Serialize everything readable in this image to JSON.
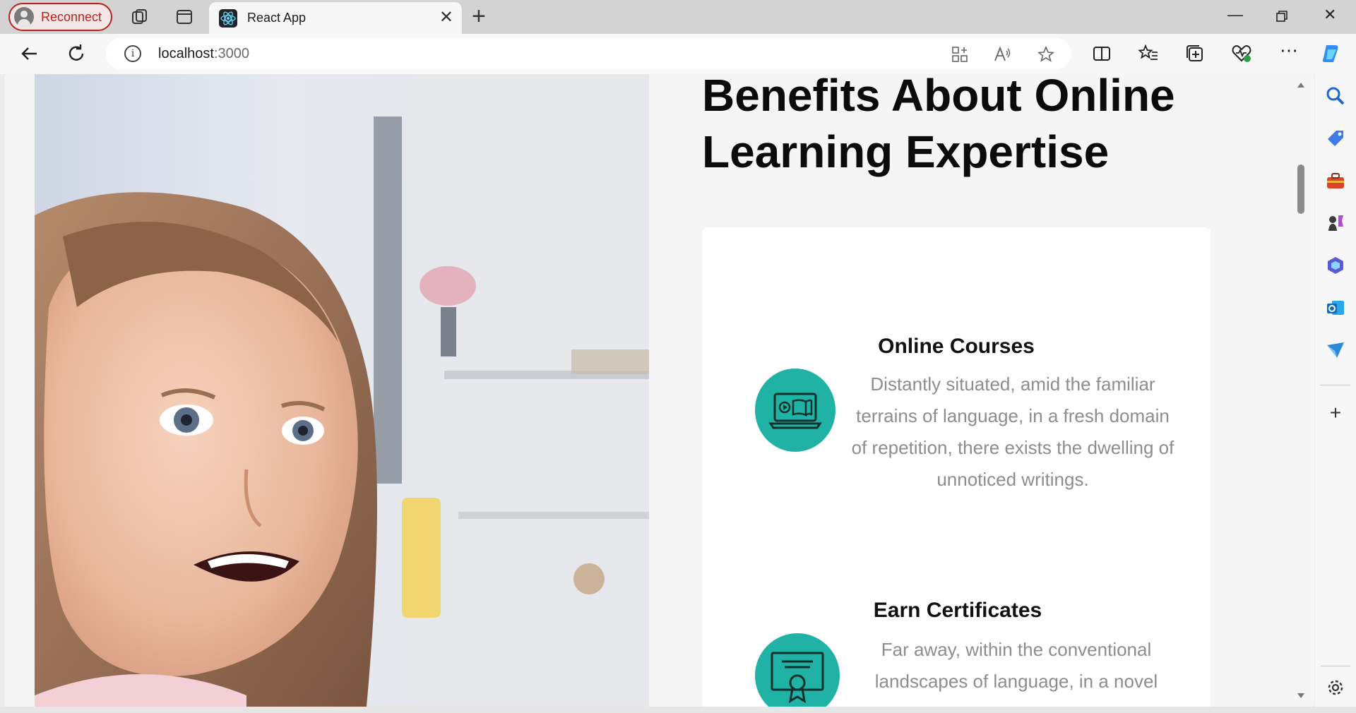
{
  "browser": {
    "reconnect_label": "Reconnect",
    "tab_title": "React App",
    "url_host": "localhost",
    "url_port": ":3000",
    "sidebar_icons": [
      "search-icon",
      "tag-icon",
      "toolbox-icon",
      "chess-icon",
      "copilot-icon",
      "outlook-icon",
      "send-icon",
      "add-icon",
      "settings-icon"
    ]
  },
  "page": {
    "heading": "Benefits About Online Learning Expertise",
    "features": [
      {
        "title": "Online Courses",
        "text": "Distantly situated, amid the familiar terrains of language, in a fresh domain of repetition, there exists the dwelling of unnoticed writings.",
        "icon": "laptop-book-icon"
      },
      {
        "title": "Earn Certificates",
        "text": "Far away, within the conventional landscapes of language, in a novel",
        "icon": "certificate-icon"
      }
    ]
  },
  "colors": {
    "accent": "#20b2a4",
    "reconnect": "#b3261e"
  }
}
